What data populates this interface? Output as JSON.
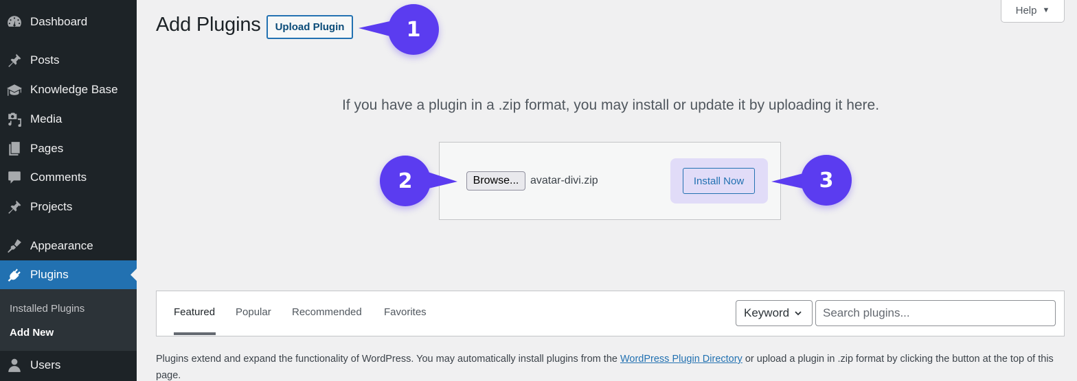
{
  "sidebar": {
    "items": [
      {
        "label": "Dashboard",
        "icon": "dashboard-icon"
      },
      {
        "label": "Posts",
        "icon": "pin-icon"
      },
      {
        "label": "Knowledge Base",
        "icon": "graduation-cap-icon"
      },
      {
        "label": "Media",
        "icon": "media-icon"
      },
      {
        "label": "Pages",
        "icon": "pages-icon"
      },
      {
        "label": "Comments",
        "icon": "comment-icon"
      },
      {
        "label": "Projects",
        "icon": "pin-icon"
      },
      {
        "label": "Appearance",
        "icon": "paintbrush-icon"
      },
      {
        "label": "Plugins",
        "icon": "plug-icon",
        "active": true
      },
      {
        "label": "Users",
        "icon": "user-icon"
      }
    ],
    "submenu": [
      {
        "label": "Installed Plugins"
      },
      {
        "label": "Add New",
        "current": true
      }
    ]
  },
  "header": {
    "title": "Add Plugins",
    "upload_button": "Upload Plugin",
    "help_button": "Help",
    "help_caret": "▼"
  },
  "upload": {
    "description": "If you have a plugin in a .zip format, you may install or update it by uploading it here.",
    "browse_button": "Browse...",
    "file_name": "avatar-divi.zip",
    "install_button": "Install Now"
  },
  "callouts": [
    {
      "number": "1"
    },
    {
      "number": "2"
    },
    {
      "number": "3"
    }
  ],
  "filter": {
    "tabs": [
      {
        "label": "Featured",
        "current": true
      },
      {
        "label": "Popular"
      },
      {
        "label": "Recommended"
      },
      {
        "label": "Favorites"
      }
    ],
    "search_type": "Keyword",
    "search_placeholder": "Search plugins..."
  },
  "info": {
    "text_before": "Plugins extend and expand the functionality of WordPress. You may automatically install plugins from the ",
    "link": "WordPress Plugin Directory",
    "text_after": " or upload a plugin in .zip format by clicking the button at the top of this page."
  },
  "colors": {
    "sidebar_bg": "#1d2327",
    "active_menu": "#2271b1",
    "callout": "#5b3cf0",
    "install_highlight": "#e1dcf8"
  }
}
